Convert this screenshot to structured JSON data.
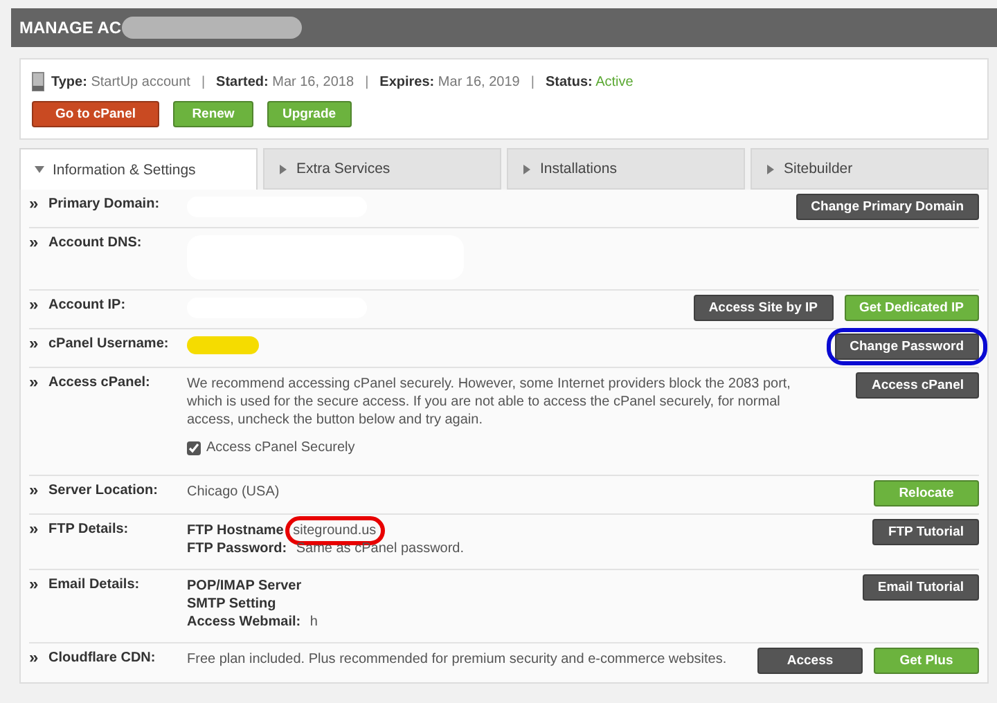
{
  "header": {
    "title": "MANAGE AC"
  },
  "summary": {
    "separator": "|",
    "fields": [
      {
        "label": "Type:",
        "value": "StartUp account",
        "kind": "plain"
      },
      {
        "label": "Started:",
        "value": "Mar 16, 2018",
        "kind": "plain"
      },
      {
        "label": "Expires:",
        "value": "Mar 16, 2019",
        "kind": "plain"
      },
      {
        "label": "Status:",
        "value": "Active",
        "kind": "status"
      }
    ],
    "buttons": [
      {
        "label": "Go to cPanel",
        "kind": "orange"
      },
      {
        "label": "Renew",
        "kind": "green"
      },
      {
        "label": "Upgrade",
        "kind": "green"
      }
    ]
  },
  "tabs": [
    {
      "label": "Information & Settings",
      "selected": true
    },
    {
      "label": "Extra Services",
      "selected": false
    },
    {
      "label": "Installations",
      "selected": false
    },
    {
      "label": "Sitebuilder",
      "selected": false
    }
  ],
  "rows": [
    {
      "bullet": "»",
      "label": "Primary Domain:",
      "kind": "redacted",
      "buttons": [
        {
          "label": "Change Primary Domain",
          "kind": "dark"
        }
      ]
    },
    {
      "bullet": "»",
      "label": "Account DNS:",
      "kind": "redacted-tall",
      "buttons": []
    },
    {
      "bullet": "»",
      "label": "Account IP:",
      "kind": "redacted",
      "buttons": [
        {
          "label": "Access Site by IP",
          "kind": "dark"
        },
        {
          "label": "Get Dedicated IP",
          "kind": "green"
        }
      ]
    },
    {
      "bullet": "»",
      "label": "cPanel Username:",
      "kind": "highlighted",
      "buttons": [
        {
          "label": "Change Password",
          "kind": "dark",
          "scribbled": true
        }
      ]
    },
    {
      "bullet": "»",
      "label": "Access cPanel:",
      "kind": "paragraph",
      "text": "We recommend accessing cPanel securely. However, some Internet providers block the 2083 port, which is used for the secure access. If you are not able to access the cPanel securely, for normal access, uncheck the button below and try again.",
      "checkbox": {
        "label": "Access cPanel Securely",
        "checked": true
      },
      "buttons": [
        {
          "label": "Access cPanel",
          "kind": "dark"
        }
      ]
    },
    {
      "bullet": "»",
      "label": "Server Location:",
      "kind": "text",
      "text": "Chicago (USA)",
      "buttons": [
        {
          "label": "Relocate",
          "kind": "green"
        }
      ]
    },
    {
      "bullet": "»",
      "label": "FTP Details:",
      "kind": "pairs",
      "pairs": [
        {
          "label": "FTP Hostname",
          "value": "siteground.us",
          "scribbled": true
        },
        {
          "label": "FTP Password:",
          "value": "Same as cPanel password."
        }
      ],
      "buttons": [
        {
          "label": "FTP Tutorial",
          "kind": "dark"
        }
      ]
    },
    {
      "bullet": "»",
      "label": "Email Details:",
      "kind": "pairs",
      "pairs": [
        {
          "label": "POP/IMAP Server"
        },
        {
          "label": "SMTP Setting"
        },
        {
          "label": "Access Webmail:",
          "value": "h"
        }
      ],
      "buttons": [
        {
          "label": "Email Tutorial",
          "kind": "dark"
        }
      ]
    },
    {
      "bullet": "»",
      "label": "Cloudflare CDN:",
      "kind": "text",
      "text": "Free plan included. Plus recommended for premium security and e-commerce websites.",
      "buttons": [
        {
          "label": "Access",
          "kind": "dark"
        },
        {
          "label": "Get Plus",
          "kind": "green"
        }
      ]
    }
  ]
}
